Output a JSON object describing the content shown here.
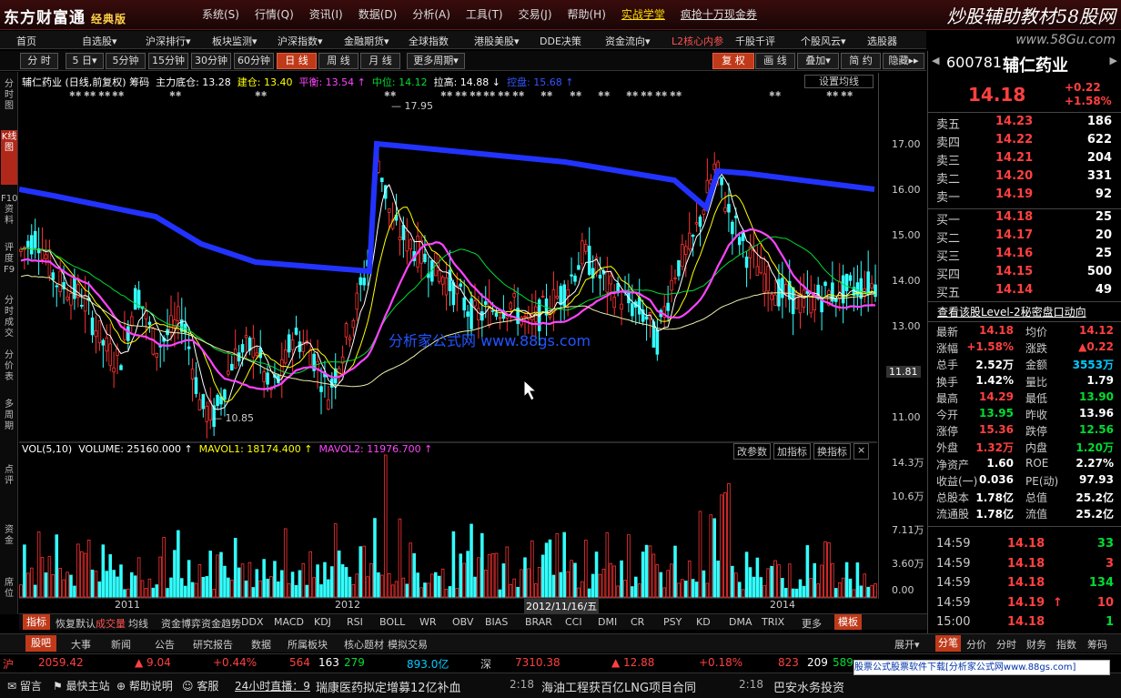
{
  "app": {
    "logo": "东方财富通",
    "edition": "经典版",
    "menus": [
      "系统(S)",
      "行情(Q)",
      "资讯(I)",
      "数据(D)",
      "分析(A)",
      "工具(T)",
      "交易(J)",
      "帮助(H)"
    ],
    "promo1": "实战学堂",
    "promo2": "疯抢十万现金券",
    "wm1": "炒股辅助教材58股网",
    "wm2": "www.58Gu.com"
  },
  "nav": [
    "首页",
    "自选股▾",
    "沪深排行▾",
    "板块监测▾",
    "沪深指数▾",
    "金融期货▾",
    "全球指数",
    "港股美股▾",
    "DDE决策",
    "资金流向▾",
    "L2核心内参",
    "千股千评",
    "个股风云▾",
    "选股器"
  ],
  "periods": [
    "分 时",
    "5 日▾",
    "5分钟",
    "15分钟",
    "30分钟",
    "60分钟",
    "日 线",
    "周 线",
    "月 线",
    "更多周期▾"
  ],
  "active_period": "日 线",
  "rtools": [
    "复 权",
    "画 线",
    "叠加▾",
    "简 约",
    "隐藏▸▸"
  ],
  "leftnav": [
    "分时图",
    "K线图",
    "F10资料",
    "评度F9",
    "分时成交",
    "分价表",
    "多周期",
    "点评",
    "资金",
    "席位"
  ],
  "chart": {
    "stock": "辅仁药业 (日线,前复权)",
    "chips": "筹码",
    "main_cost": "主力底仓: 13.28",
    "build": "建仓: 13.40",
    "balance": "平衡: 13.54 ↑",
    "mid": "中位: 14.12",
    "lift": "拉高: 14.88 ↓",
    "ctrl": "控盘: 15.68 ↑",
    "setbtn": "设置均线",
    "high": "17.95",
    "low": "10.85",
    "cur_price": "11.81",
    "wm": "分析家公式网 www.88gs.com",
    "yticks": [
      "17.00",
      "16.00",
      "15.00",
      "14.00",
      "13.00",
      "11.00"
    ]
  },
  "vol": {
    "label": "VOL(5,10)",
    "volume": "VOLUME: 25160.000 ↑",
    "mavol1": "MAVOL1: 18174.400 ↑",
    "mavol2": "MAVOL2: 11976.700 ↑",
    "btns": [
      "改参数",
      "加指标",
      "换指标",
      "×"
    ],
    "yticks": [
      "14.3万",
      "10.6万",
      "7.11万",
      "3.60万",
      "0.00"
    ]
  },
  "xaxis": {
    "y2011": "2011",
    "y2012": "2012",
    "date": "2012/11/16/五",
    "y2014": "2014"
  },
  "indicators": [
    "指标",
    "恢复默认",
    "成交量",
    "均线",
    "资金博弈",
    "资金趋势",
    "DDX",
    "MACD",
    "KDJ",
    "RSI",
    "BOLL",
    "WR",
    "OBV",
    "BIAS",
    "BRAR",
    "CCI",
    "DMI",
    "CR",
    "PSY",
    "KD",
    "DMA",
    "TRIX",
    "更多",
    "模板"
  ],
  "news_tabs": [
    "股吧",
    "大事",
    "新闻",
    "公告",
    "研究报告",
    "数据",
    "所属板块",
    "核心题材",
    "模拟交易"
  ],
  "right_tabs": [
    "展开▾",
    "分笔",
    "分价",
    "分时",
    "财务",
    "指数",
    "筹码"
  ],
  "quote": {
    "code": "600781",
    "name": "辅仁药业",
    "price": "14.18",
    "chg": "+0.22",
    "pct": "+1.58%"
  },
  "asks": [
    [
      "卖五",
      "14.23",
      "186"
    ],
    [
      "卖四",
      "14.22",
      "622"
    ],
    [
      "卖三",
      "14.21",
      "204"
    ],
    [
      "卖二",
      "14.20",
      "331"
    ],
    [
      "卖一",
      "14.19",
      "92"
    ]
  ],
  "bids": [
    [
      "买一",
      "14.18",
      "25"
    ],
    [
      "买二",
      "14.17",
      "20"
    ],
    [
      "买三",
      "14.16",
      "25"
    ],
    [
      "买四",
      "14.15",
      "500"
    ],
    [
      "买五",
      "14.14",
      "49"
    ]
  ],
  "level2": "查看该股Level-2秘密盘口动向",
  "stats": [
    [
      "最新",
      "14.18",
      "均价",
      "14.12"
    ],
    [
      "涨幅",
      "+1.58%",
      "涨跌",
      "▲0.22"
    ],
    [
      "总手",
      "2.52万",
      "金额",
      "3553万"
    ],
    [
      "换手",
      "1.42%",
      "量比",
      "1.79"
    ],
    [
      "最高",
      "14.29",
      "最低",
      "13.90"
    ],
    [
      "今开",
      "13.95",
      "昨收",
      "13.96"
    ],
    [
      "涨停",
      "15.36",
      "跌停",
      "12.56"
    ],
    [
      "外盘",
      "1.32万",
      "内盘",
      "1.20万"
    ],
    [
      "净资产",
      "1.60",
      "ROE",
      "2.27%"
    ],
    [
      "收益(一)",
      "0.036",
      "PE(动)",
      "97.93"
    ],
    [
      "总股本",
      "1.78亿",
      "总值",
      "25.2亿"
    ],
    [
      "流通股",
      "1.78亿",
      "流值",
      "25.2亿"
    ]
  ],
  "ticks": [
    [
      "14:59",
      "14.18",
      "33",
      ""
    ],
    [
      "14:59",
      "14.18",
      "3",
      ""
    ],
    [
      "14:59",
      "14.18",
      "134",
      ""
    ],
    [
      "14:59",
      "14.19",
      "10",
      "↑"
    ],
    [
      "15:00",
      "14.18",
      "1",
      ""
    ]
  ],
  "ticker": {
    "sh_lbl": "沪",
    "sh": "2059.42",
    "sh_chg": "▲ 9.04",
    "sh_pct": "+0.44%",
    "sh_ud": "564",
    "sh_flat": "163",
    "sh_dn": "279",
    "sh_amt": "893.0亿",
    "sz_lbl": "深",
    "sz": "7310.38",
    "sz_chg": "▲ 12.88",
    "sz_pct": "+0.18%",
    "sz_ud": "823",
    "sz_flat": "209",
    "sz_dn": "589"
  },
  "status": {
    "msg": "留言",
    "fast": "最快主站",
    "help": "帮助说明",
    "cs": "客服",
    "live": "24小时直播：9",
    "n1": "瑞康医药拟定增募12亿补血",
    "t1": "2:18",
    "n2": "海油工程获百亿LNG项目合同",
    "t2": "2:18",
    "n3": "巴安水务投资"
  },
  "adfooter": "股票公式股票软件下载[分析家公式网www.88gs.com]"
}
